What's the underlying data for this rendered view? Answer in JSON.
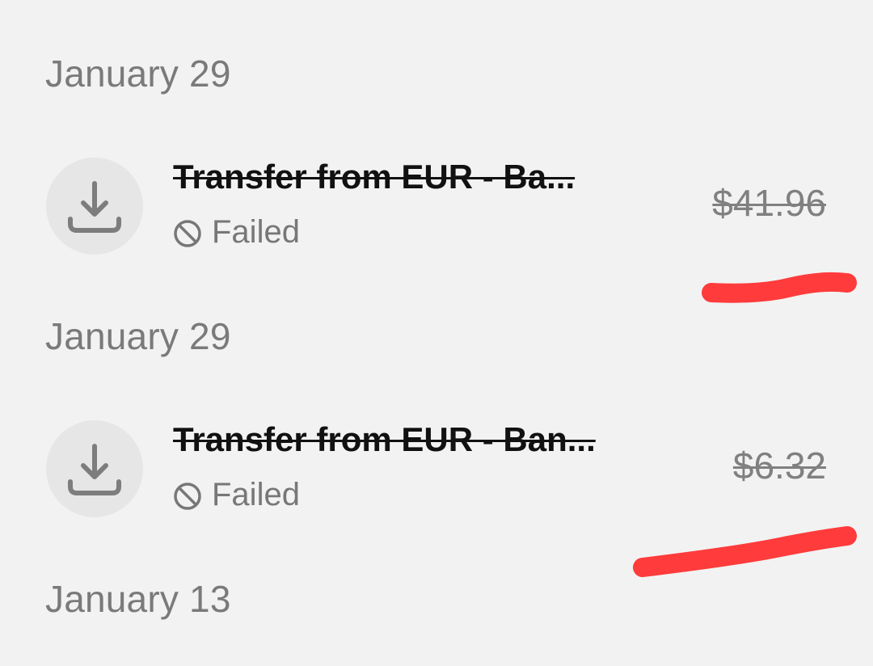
{
  "groups": [
    {
      "date": "January 29",
      "transaction": {
        "title": "Transfer from EUR - Ba...",
        "status": "Failed",
        "amount": "$41.96",
        "icon": "download-icon",
        "status_icon": "blocked-icon"
      }
    },
    {
      "date": "January 29",
      "transaction": {
        "title": "Transfer from EUR - Ban...",
        "status": "Failed",
        "amount": "$6.32",
        "icon": "download-icon",
        "status_icon": "blocked-icon"
      }
    },
    {
      "date": "January 13"
    }
  ],
  "colors": {
    "background": "#f2f2f2",
    "icon_circle": "#e6e6e6",
    "icon_stroke": "#7d7d7d",
    "title": "#111111",
    "muted_text": "#7a7a7a",
    "annotation_red": "#ff3b3b"
  }
}
